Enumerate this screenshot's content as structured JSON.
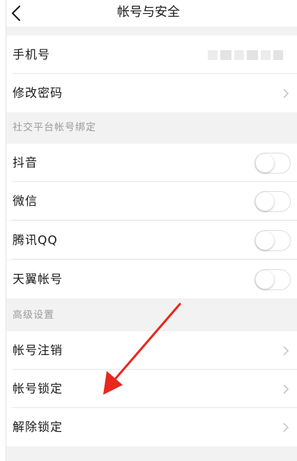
{
  "nav": {
    "title": "帐号与安全"
  },
  "account": {
    "phone_label": "手机号",
    "password_label": "修改密码"
  },
  "social": {
    "header": "社交平台帐号绑定",
    "items": [
      {
        "label": "抖音",
        "enabled": false
      },
      {
        "label": "微信",
        "enabled": false
      },
      {
        "label": "腾讯QQ",
        "enabled": false
      },
      {
        "label": "天翼帐号",
        "enabled": false
      }
    ]
  },
  "advanced": {
    "header": "高级设置",
    "items": [
      {
        "label": "帐号注销"
      },
      {
        "label": "帐号锁定"
      },
      {
        "label": "解除锁定"
      }
    ]
  },
  "colors": {
    "background": "#f2f2f2",
    "annotation_arrow": "#e8281e"
  },
  "icons": [
    "back-arrow-icon",
    "chevron-right-icon"
  ]
}
